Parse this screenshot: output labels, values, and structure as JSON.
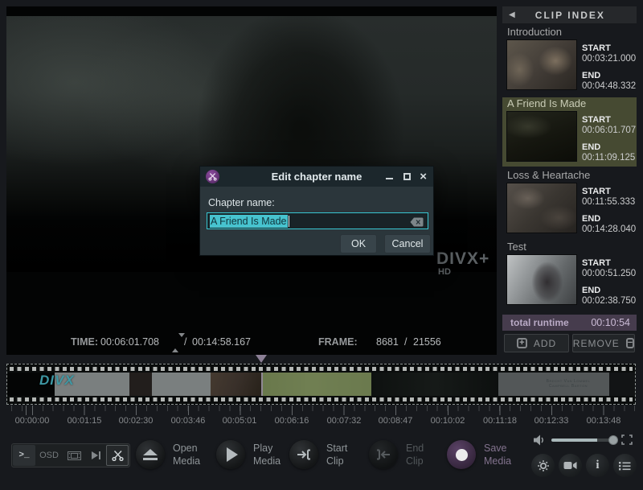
{
  "colors": {
    "accent_cyan": "#3cc5d0",
    "selected_clip_bg": "#464a32",
    "runtime_bar_bg": "#463c4d",
    "save_accent": "#53405c",
    "app_bg": "#17191d"
  },
  "video": {
    "watermark_line1": "DIVX+",
    "watermark_line2": "HD",
    "status": {
      "time_label": "TIME:",
      "time_current": "00:06:01.708",
      "time_separator": "/",
      "time_total": "00:14:58.167",
      "frame_label": "FRAME:",
      "frame_current": "8681",
      "frame_separator": "/",
      "frame_total": "21556"
    }
  },
  "dialog": {
    "title": "Edit chapter name",
    "field_label": "Chapter name:",
    "input_value": "A Friend Is Made",
    "ok_label": "OK",
    "cancel_label": "Cancel"
  },
  "clip_index": {
    "collapse_icon": "◀",
    "header": "CLIP INDEX",
    "start_label": "START",
    "end_label": "END",
    "clips": [
      {
        "name": "Introduction",
        "start": "00:03:21.000",
        "end": "00:04:48.332",
        "selected": false
      },
      {
        "name": "A Friend Is Made",
        "start": "00:06:01.707",
        "end": "00:11:09.125",
        "selected": true
      },
      {
        "name": "Loss & Heartache",
        "start": "00:11:55.333",
        "end": "00:14:28.040",
        "selected": false
      },
      {
        "name": "Test",
        "start": "00:00:51.250",
        "end": "00:02:38.750",
        "selected": false
      }
    ],
    "total_runtime_label": "total runtime",
    "total_runtime_value": "00:10:54",
    "add_label": "ADD",
    "add_icon": "+",
    "remove_label": "REMOVE",
    "remove_icon": "−"
  },
  "timeline": {
    "film_logo": "DIVX",
    "credits_line1": "Brecht Van Lommel",
    "credits_line2": "Campbell Barton",
    "tick_labels": [
      "00:00:00",
      "00:01:15",
      "00:02:30",
      "00:03:46",
      "00:05:01",
      "00:06:16",
      "00:07:32",
      "00:08:47",
      "00:10:02",
      "00:11:18",
      "00:12:33",
      "00:13:48"
    ]
  },
  "toolbar": {
    "terminal_label": ">_",
    "osd_label": "OSD"
  },
  "transport": {
    "open_label": "Open\nMedia",
    "play_label": "Play\nMedia",
    "start_label": "Start\nClip",
    "end_label": "End\nClip",
    "save_label": "Save\nMedia"
  }
}
